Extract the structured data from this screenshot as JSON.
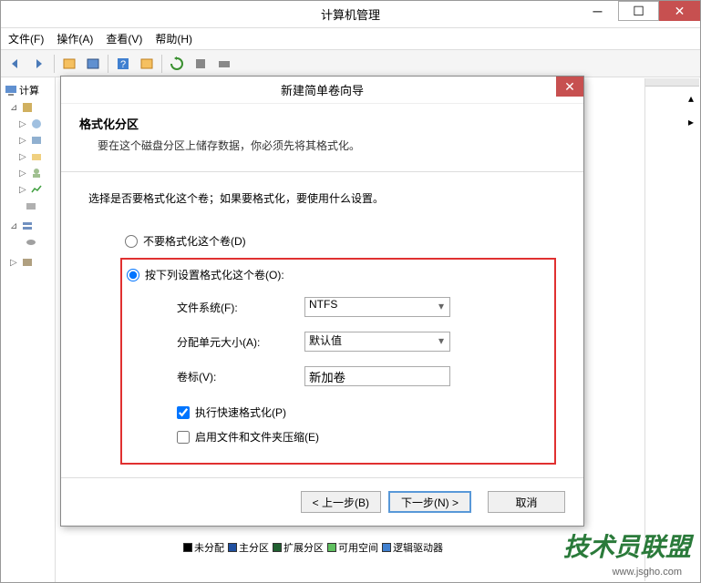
{
  "window": {
    "title": "计算机管理"
  },
  "menu": {
    "file": "文件(F)",
    "action": "操作(A)",
    "view": "查看(V)",
    "help": "帮助(H)"
  },
  "tree": {
    "root": "计算"
  },
  "dialog": {
    "title": "新建简单卷向导",
    "header_title": "格式化分区",
    "header_desc": "要在这个磁盘分区上储存数据，你必须先将其格式化。",
    "instruction": "选择是否要格式化这个卷；如果要格式化，要使用什么设置。",
    "radio_no_format": "不要格式化这个卷(D)",
    "radio_format": "按下列设置格式化这个卷(O):",
    "filesystem_label": "文件系统(F):",
    "filesystem_value": "NTFS",
    "alloc_label": "分配单元大小(A):",
    "alloc_value": "默认值",
    "vollabel_label": "卷标(V):",
    "vollabel_value": "新加卷",
    "quick_format": "执行快速格式化(P)",
    "compression": "启用文件和文件夹压缩(E)",
    "btn_back": "< 上一步(B)",
    "btn_next": "下一步(N) >",
    "btn_cancel": "取消"
  },
  "legend": {
    "unallocated": "未分配",
    "primary": "主分区",
    "extended": "扩展分区",
    "free": "可用空间",
    "logical": "逻辑驱动器"
  },
  "watermark": "技术员联盟",
  "watermark_sub": "www.jsgho.com"
}
